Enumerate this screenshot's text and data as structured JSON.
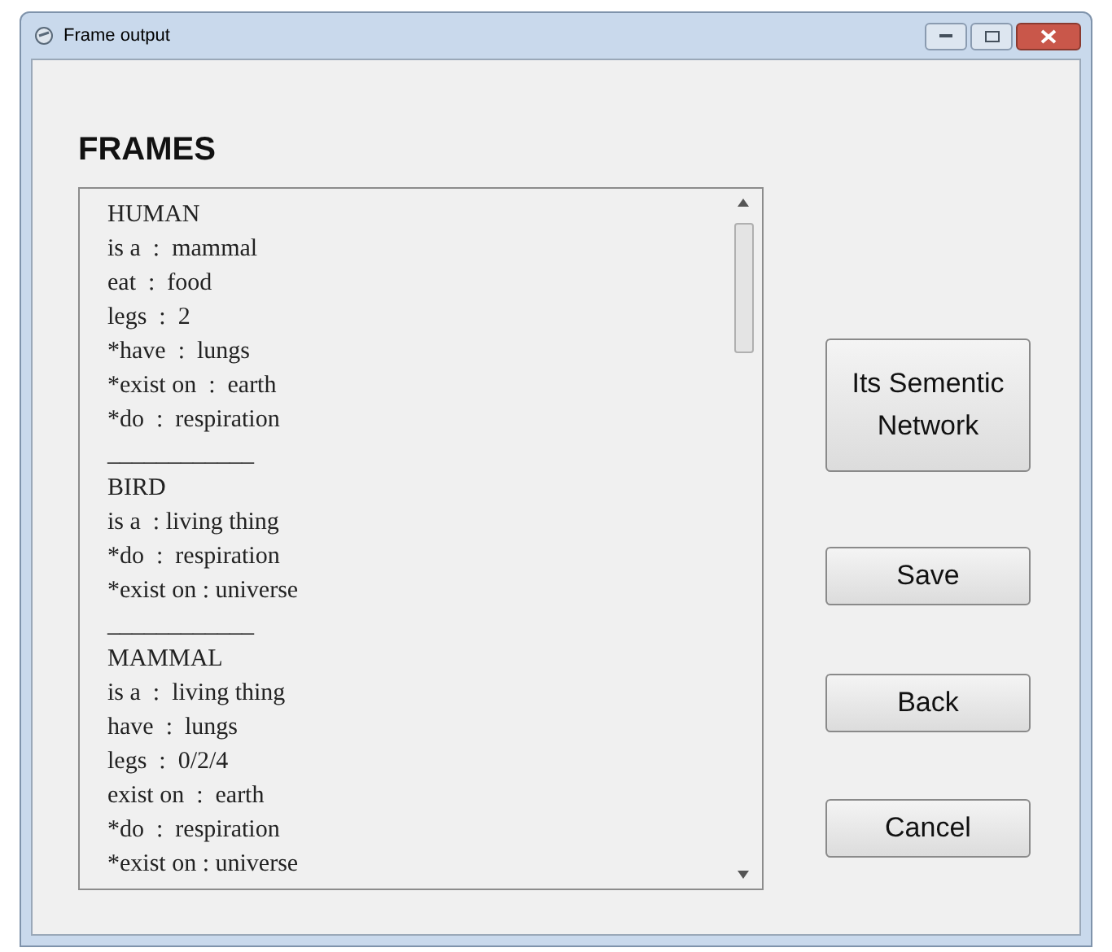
{
  "window": {
    "title": "Frame output"
  },
  "heading": "FRAMES",
  "frames_text": {
    "lines": [
      "HUMAN",
      "is a  :  mammal",
      "eat  :  food",
      "legs  :  2",
      "*have  :  lungs",
      "*exist on  :  earth",
      "*do  :  respiration",
      "____________",
      "BIRD",
      "is a  : living thing",
      "*do  :  respiration",
      "*exist on : universe",
      "____________",
      "MAMMAL",
      "is a  :  living thing",
      "have  :  lungs",
      "legs  :  0/2/4",
      "exist on  :  earth",
      "*do  :  respiration",
      "*exist on : universe"
    ]
  },
  "buttons": [
    {
      "label": "Its Sementic Network",
      "kind": "tall"
    },
    {
      "label": "Save",
      "kind": "normal"
    },
    {
      "label": "Back",
      "kind": "normal"
    },
    {
      "label": "Cancel",
      "kind": "normal"
    }
  ]
}
